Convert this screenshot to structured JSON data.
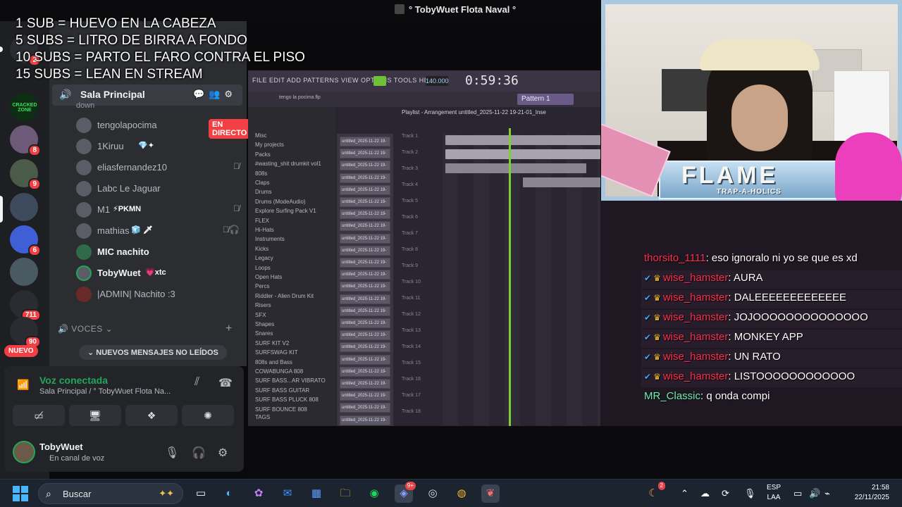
{
  "window": {
    "title": "° TobyWuet Flota Naval °"
  },
  "overlay_goals": [
    "1 SUB = HUEVO EN LA CABEZA",
    "5 SUBS = LITRO DE BIRRA A FONDO",
    "10 SUBS = PARTO EL FARO CONTRA EL PISO",
    "15 SUBS = LEAN EN STREAM"
  ],
  "discord": {
    "rail": {
      "badges": [
        "2",
        "8",
        "9",
        "6",
        "711",
        "90"
      ],
      "new_label": "NUEVO",
      "server_label_cracked": "CRACKED ZONE"
    },
    "channel": {
      "name": "Sala Principal",
      "status": "down",
      "live_label": "EN DIRECTO",
      "users": [
        {
          "name": "tengolapocima",
          "tag": ""
        },
        {
          "name": "1Kiruu",
          "tag": "💎✦"
        },
        {
          "name": "eliasfernandez10",
          "tag": ""
        },
        {
          "name": "Labc Le Jaguar",
          "tag": ""
        },
        {
          "name": "M1",
          "tag": "⚡PKMN"
        },
        {
          "name": "mathias",
          "tag": "🧊 🗡"
        },
        {
          "name": "MIC nachito",
          "tag": ""
        },
        {
          "name": "TobyWuet",
          "tag": "💗xtc"
        },
        {
          "name": "|ADMIN| Nachito :3",
          "tag": ""
        }
      ],
      "voices_label": "VOCES",
      "new_messages": "NUEVOS MENSAJES NO LEÍDOS"
    },
    "voice": {
      "connected": "Voz conectada",
      "location": "Sala Principal / ° TobyWuet Flota Na...",
      "user": "TobyWuet",
      "user_status": "En canal de voz"
    }
  },
  "fl_studio": {
    "menu": "FILE EDIT ADD PATTERNS VIEW OPTIONS TOOLS HELP",
    "tempo": "140.000",
    "time": "0:59:36",
    "pattern": "Pattern 1",
    "playlist_title": "Playlist - Arrangement  untitled_2025-11-22 19-21-01_Inse",
    "project_hint": "tengo la pocima.flp",
    "browser_items": [
      "Misc",
      "My projects",
      "Packs",
      "#wasting_shit drumkit vol1",
      "808s",
      "Claps",
      "Drums",
      "Drums (ModeAudio)",
      "Explore Surfing Pack V1",
      "FLEX",
      "Hi-Hats",
      "Instruments",
      "Kicks",
      "Legacy",
      "Loops",
      "Open Hats",
      "Percs",
      "Riddler - Alien Drum Kit",
      "Risers",
      "SFX",
      "Shapes",
      "Snares",
      "SURF KIT V2",
      "SURFSWAG KIT",
      "808s and Bass",
      "COWABUNGA 808",
      "SURF BASS...AR VIBRATO",
      "SURF BASS GUITAR",
      "SURF BASS PLUCK 808",
      "SURF BOUNCE 808"
    ],
    "tracks": [
      "Track 1",
      "Track 2",
      "Track 3",
      "Track 4",
      "Track 5",
      "Track 6",
      "Track 7",
      "Track 8",
      "Track 9",
      "Track 10",
      "Track 11",
      "Track 12",
      "Track 13",
      "Track 14",
      "Track 15",
      "Track 16",
      "Track 17",
      "Track 18"
    ],
    "channel_label": "untitled_2025-11-22 19-",
    "tags_label": "TAGS"
  },
  "chat": [
    {
      "user": "thorsito_1111",
      "msg": "eso ignoralo ni yo se que es xd",
      "badges": false,
      "color": "red"
    },
    {
      "user": "wise_hamster",
      "msg": "AURA",
      "badges": true,
      "color": "red"
    },
    {
      "user": "wise_hamster",
      "msg": "DALEEEEEEEEEEEEE",
      "badges": true,
      "color": "red"
    },
    {
      "user": "wise_hamster",
      "msg": "JOJOOOOOOOOOOOOOO",
      "badges": true,
      "color": "red"
    },
    {
      "user": "wise_hamster",
      "msg": "MONKEY APP",
      "badges": true,
      "color": "red"
    },
    {
      "user": "wise_hamster",
      "msg": "UN RATO",
      "badges": true,
      "color": "red"
    },
    {
      "user": "wise_hamster",
      "msg": "LISTOOOOOOOOOOOO",
      "badges": true,
      "color": "red"
    },
    {
      "user": "MR_Classic",
      "msg": "q onda compi",
      "badges": false,
      "color": "green"
    }
  ],
  "stream": {
    "banner_title": "FLAME",
    "banner_sub": "TRAP-A-HOLICS"
  },
  "taskbar": {
    "search_placeholder": "Buscar",
    "badge_discord": "9+",
    "badge_weather": "2",
    "lang_top": "ESP",
    "lang_bottom": "LAA",
    "time": "21:58",
    "date": "22/11/2025"
  }
}
